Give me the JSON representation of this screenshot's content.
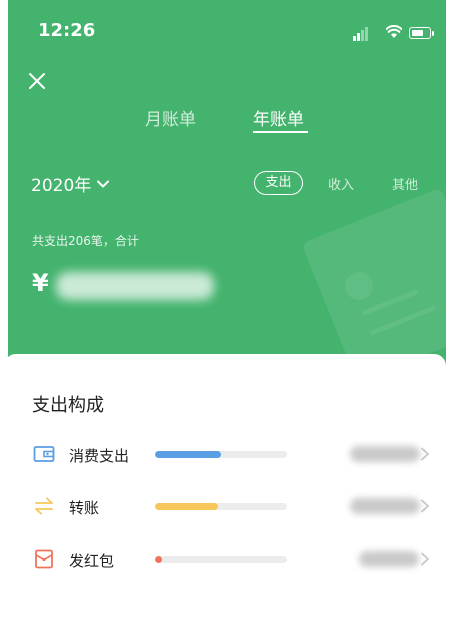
{
  "status_bar": {
    "time": "12:26"
  },
  "tabs": [
    {
      "label": "月账单",
      "active": false
    },
    {
      "label": "年账单",
      "active": true
    }
  ],
  "year_selector": {
    "label": "2020年"
  },
  "filters": [
    {
      "label": "支出",
      "active": true
    },
    {
      "label": "收入",
      "active": false
    },
    {
      "label": "其他",
      "active": false
    }
  ],
  "summary": {
    "text": "共支出206笔，合计",
    "currency": "¥"
  },
  "breakdown": {
    "title": "支出构成",
    "items": [
      {
        "label": "消费支出",
        "icon": "wallet-icon",
        "color": "#5a9ee6",
        "ratio": 0.5
      },
      {
        "label": "转账",
        "icon": "transfer-icon",
        "color": "#f7c75a",
        "ratio": 0.48
      },
      {
        "label": "发红包",
        "icon": "red-envelope-icon",
        "color": "#f0735a",
        "ratio": 0.05
      }
    ]
  },
  "colors": {
    "header": "#44b36e",
    "accent_blue": "#5a9ee6",
    "accent_yellow": "#f7c75a",
    "accent_red": "#f0735a"
  }
}
